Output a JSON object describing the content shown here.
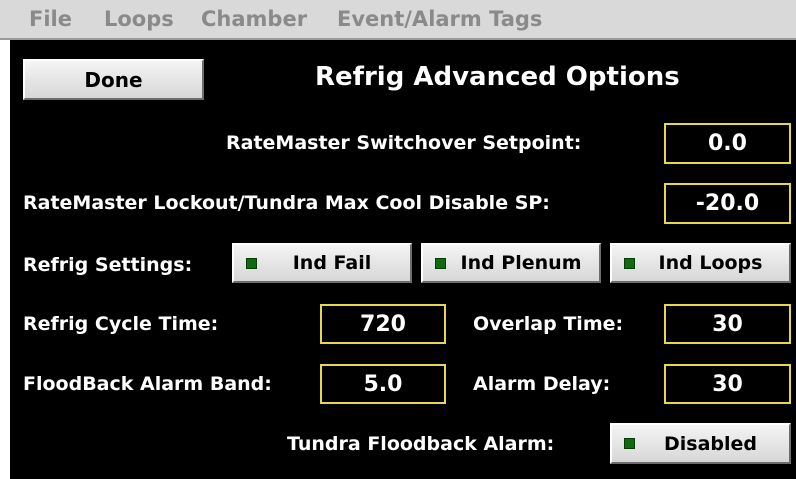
{
  "menu": [
    "File",
    "Loops",
    "Chamber",
    "Event/Alarm Tags"
  ],
  "title": "Refrig Advanced Options",
  "done_label": "Done",
  "switchover": {
    "label": "RateMaster Switchover Setpoint:",
    "value": "0.0"
  },
  "lockout": {
    "label": "RateMaster Lockout/Tundra Max Cool Disable SP:",
    "value": "-20.0"
  },
  "refrig_settings": {
    "label": "Refrig Settings:",
    "buttons": [
      "Ind Fail",
      "Ind Plenum",
      "Ind Loops"
    ]
  },
  "cycle_time": {
    "label": "Refrig Cycle Time:",
    "value": "720"
  },
  "overlap_time": {
    "label": "Overlap Time:",
    "value": "30"
  },
  "floodback_band": {
    "label": "FloodBack Alarm Band:",
    "value": "5.0"
  },
  "alarm_delay": {
    "label": "Alarm Delay:",
    "value": "30"
  },
  "tundra_floodback": {
    "label": "Tundra Floodback Alarm:",
    "value": "Disabled"
  },
  "colors": {
    "field_border": "#e6d84a",
    "led": "#0f6a12",
    "background": "#000000"
  }
}
